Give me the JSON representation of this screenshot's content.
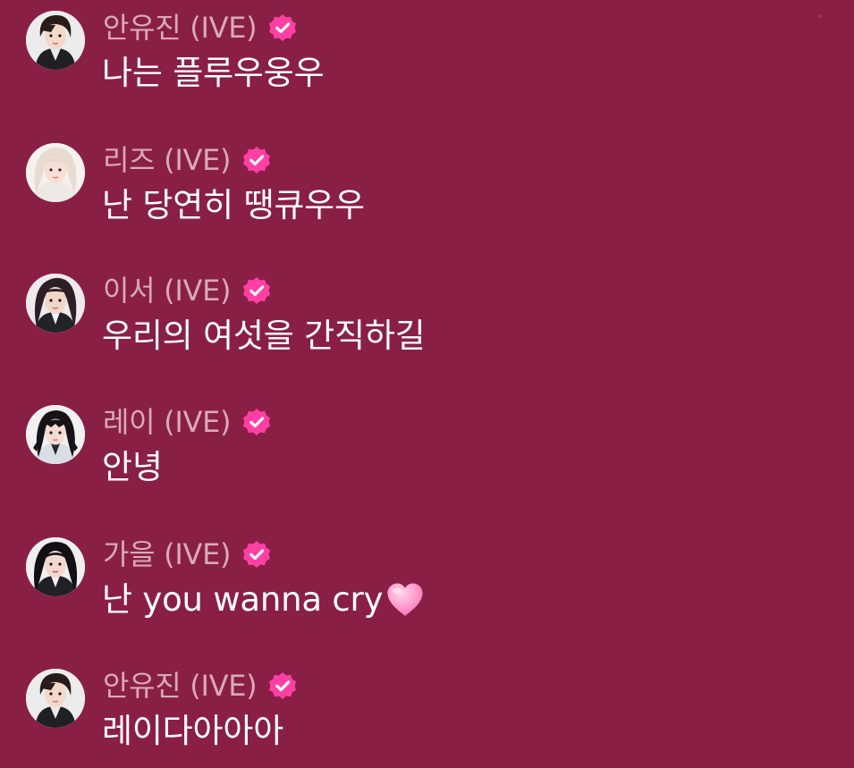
{
  "chat": {
    "messages": [
      {
        "author": "안유진 (IVE)",
        "text": "나는 플루우웅우",
        "avatar": "avatar-yujin",
        "verified": true,
        "emoji": null
      },
      {
        "author": "리즈 (IVE)",
        "text": "난 당연히 땡큐우우",
        "avatar": "avatar-liz",
        "verified": true,
        "emoji": null
      },
      {
        "author": "이서 (IVE)",
        "text": "우리의 여섯을 간직하길",
        "avatar": "avatar-leeseo",
        "verified": true,
        "emoji": null
      },
      {
        "author": "레이 (IVE)",
        "text": "안녕",
        "avatar": "avatar-rei",
        "verified": true,
        "emoji": null
      },
      {
        "author": "가을 (IVE)",
        "text": "난 you wanna cry",
        "avatar": "avatar-gaeul",
        "verified": true,
        "emoji": "pink-heart-icon"
      },
      {
        "author": "안유진 (IVE)",
        "text": "레이다아아아",
        "avatar": "avatar-yujin",
        "verified": true,
        "emoji": null
      }
    ]
  },
  "colors": {
    "background": "#8a1f45",
    "author_text": "#d9a9bb",
    "message_text": "#ffffff",
    "verified_badge": "#ff3fa4",
    "heart": "#ff9fcf"
  }
}
